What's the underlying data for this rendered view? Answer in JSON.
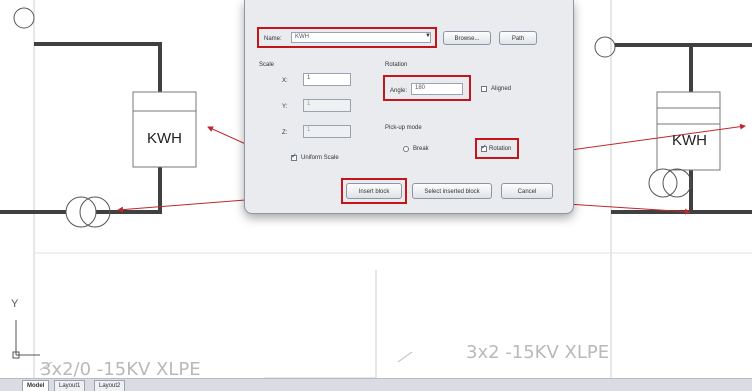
{
  "dialog": {
    "name_label": "Name:",
    "name_value": "KWH",
    "browse_button": "Browse...",
    "path_button": "Path",
    "scale_title": "Scale",
    "x_label": "X:",
    "x_value": "1",
    "y_label": "Y:",
    "y_value": "1",
    "z_label": "Z:",
    "z_value": "1",
    "uniform_scale_label": "Uniform Scale",
    "rotation_title": "Rotation",
    "angle_label": "Angle:",
    "angle_value": "180",
    "aligned_label": "Aligned",
    "pick_mode_title": "Pick-up mode",
    "pick_left_label": "Break",
    "pick_right_label": "Rotation",
    "insert_button": "Insert block",
    "select_button": "Select inserted block",
    "cancel_button": "Cancel"
  },
  "drawing": {
    "kwh_left": "KWH",
    "kwh_right": "KWH",
    "cable_left": "3x2/0 -15KV XLPE",
    "cable_right": "3x2  -15KV  XLPE",
    "axis_y": "Y"
  },
  "tabs": [
    "Model",
    "Layout1",
    "Layout2"
  ],
  "colors": {
    "highlight": "#c3161c",
    "arrow": "#c0262b",
    "wire": "#404040"
  }
}
